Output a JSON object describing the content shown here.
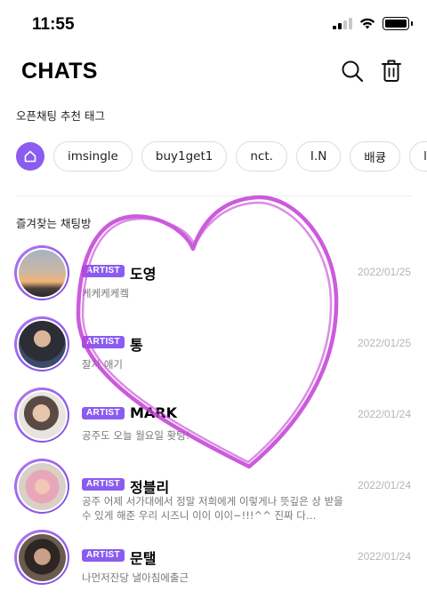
{
  "status_bar": {
    "time": "11:55"
  },
  "header": {
    "title": "CHATS",
    "search_icon": "search-icon",
    "trash_icon": "trash-icon"
  },
  "open_chat": {
    "label": "오픈채팅 추천 태그",
    "home_icon": "home-icon",
    "tags": [
      "imsingle",
      "buy1get1",
      "nct.",
      "I.N",
      "배큥",
      "lonel"
    ]
  },
  "favorites": {
    "label": "즐겨찾는 채팅방",
    "items": [
      {
        "badge": "ARTIST",
        "name": "도영",
        "date": "2022/01/25",
        "preview": "케케케케켘",
        "avatar": "sunset-avatar"
      },
      {
        "badge": "ARTIST",
        "name": "통",
        "date": "2022/01/25",
        "preview": "잘자 애기",
        "avatar": "person-avatar"
      },
      {
        "badge": "ARTIST",
        "name": "MARK",
        "date": "2022/01/24",
        "preview": "공주도 오늘 월요일 홧팅!",
        "avatar": "person-avatar"
      },
      {
        "badge": "ARTIST",
        "name": "정블리",
        "date": "2022/01/24",
        "preview": "공주 어제 서가대에서 정말 저희에게 이렇게나 뜻깊은 상 받을 수 있게 해준 우리 시즈니 이이 이이~!!!^^ 진짜 다…",
        "avatar": "person-avatar"
      },
      {
        "badge": "ARTIST",
        "name": "문탤",
        "date": "2022/01/24",
        "preview": "나먼저잔당 낼아침에출근",
        "avatar": "person-avatar"
      }
    ]
  },
  "colors": {
    "accent": "#8a5cf0",
    "heart": "#c43fd6"
  }
}
